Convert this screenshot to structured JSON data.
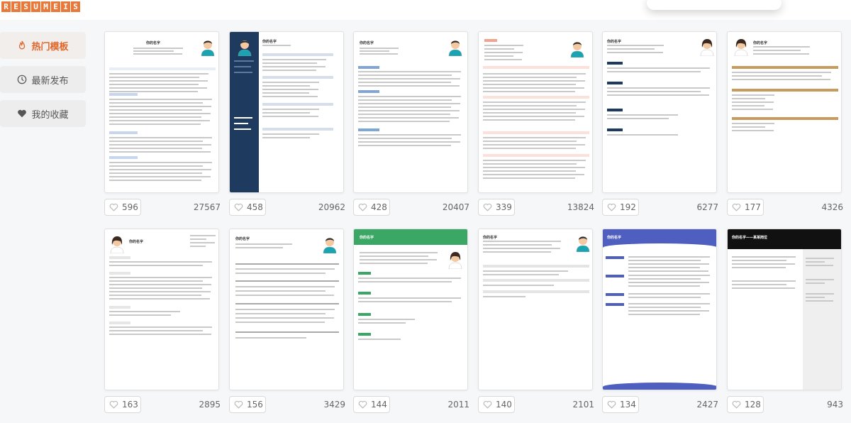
{
  "logo": {
    "letters": [
      "R",
      "E",
      "S",
      "U",
      "M",
      "E",
      "I",
      "S"
    ]
  },
  "sidebar": {
    "items": [
      {
        "label": "热门模板",
        "icon": "flame-icon",
        "active": true
      },
      {
        "label": "最新发布",
        "icon": "clock-icon",
        "active": false
      },
      {
        "label": "我的收藏",
        "icon": "heart-icon",
        "active": false
      }
    ]
  },
  "colors": {
    "accent": "#e0662a",
    "logo": "#e8793a"
  },
  "templates": [
    {
      "likes": "596",
      "views": "27567",
      "style": "classic",
      "title": "你的名字"
    },
    {
      "likes": "458",
      "views": "20962",
      "style": "navy-sidebar",
      "title": "你的名字"
    },
    {
      "likes": "428",
      "views": "20407",
      "style": "blue-lines",
      "title": "你的名字"
    },
    {
      "likes": "339",
      "views": "13824",
      "style": "salmon",
      "title": "你的名字"
    },
    {
      "likes": "192",
      "views": "6277",
      "style": "navy-badge",
      "title": "你的名字"
    },
    {
      "likes": "177",
      "views": "4326",
      "style": "brown",
      "title": "你的名字"
    },
    {
      "likes": "163",
      "views": "2895",
      "style": "female-classic",
      "title": "你的名字"
    },
    {
      "likes": "156",
      "views": "3429",
      "style": "minimal-center",
      "title": "你的名字"
    },
    {
      "likes": "144",
      "views": "2011",
      "style": "green",
      "title": "你的名字"
    },
    {
      "likes": "140",
      "views": "2101",
      "style": "grey-icons",
      "title": "你的名字"
    },
    {
      "likes": "134",
      "views": "2427",
      "style": "blue-wave",
      "title": "你的名字"
    },
    {
      "likes": "128",
      "views": "943",
      "style": "black-header",
      "title": "你的名字——某某岗位"
    }
  ]
}
